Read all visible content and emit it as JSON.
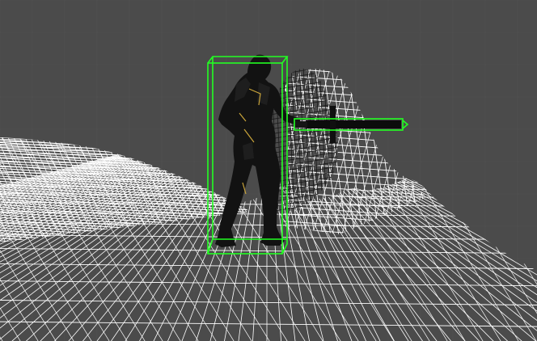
{
  "viewport": {
    "background_color": "#4b4b4b",
    "grid_color": "#5a5a5a",
    "terrain_wire_color": "#ffffff",
    "shield_wire_color": "#1a1a1a",
    "selection_box_color": "#22ff22",
    "character_color": "#121212",
    "character_highlight_color": "#c9a43a"
  },
  "scene_objects": {
    "terrain": {
      "icon": "terrain-wireframe-mesh"
    },
    "character": {
      "icon": "armored-knight-model",
      "selected": true
    },
    "shield": {
      "icon": "shield-wireframe"
    },
    "sword": {
      "icon": "sword-model",
      "selected": true
    }
  }
}
